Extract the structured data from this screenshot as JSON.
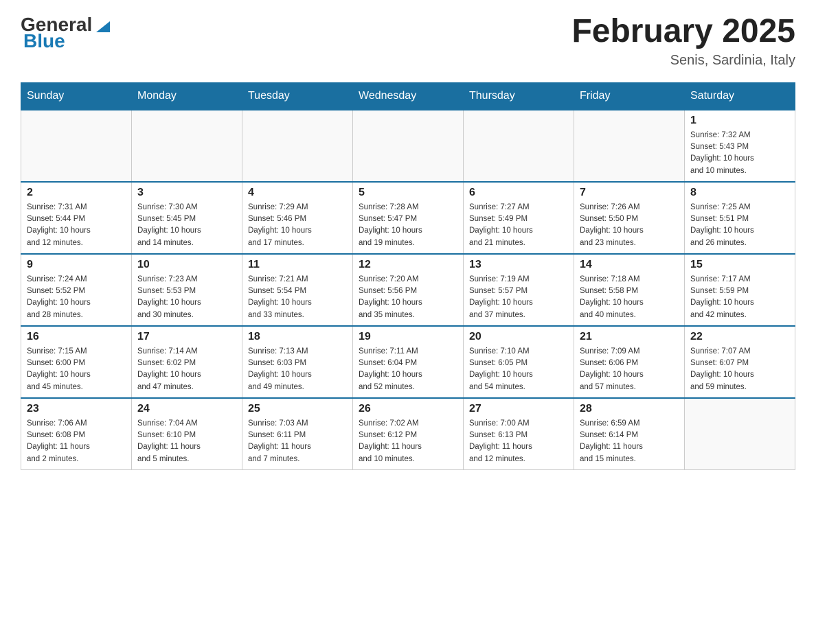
{
  "header": {
    "logo_general": "General",
    "logo_blue": "Blue",
    "month_title": "February 2025",
    "location": "Senis, Sardinia, Italy"
  },
  "days_of_week": [
    "Sunday",
    "Monday",
    "Tuesday",
    "Wednesday",
    "Thursday",
    "Friday",
    "Saturday"
  ],
  "weeks": [
    [
      {
        "day": "",
        "info": ""
      },
      {
        "day": "",
        "info": ""
      },
      {
        "day": "",
        "info": ""
      },
      {
        "day": "",
        "info": ""
      },
      {
        "day": "",
        "info": ""
      },
      {
        "day": "",
        "info": ""
      },
      {
        "day": "1",
        "info": "Sunrise: 7:32 AM\nSunset: 5:43 PM\nDaylight: 10 hours\nand 10 minutes."
      }
    ],
    [
      {
        "day": "2",
        "info": "Sunrise: 7:31 AM\nSunset: 5:44 PM\nDaylight: 10 hours\nand 12 minutes."
      },
      {
        "day": "3",
        "info": "Sunrise: 7:30 AM\nSunset: 5:45 PM\nDaylight: 10 hours\nand 14 minutes."
      },
      {
        "day": "4",
        "info": "Sunrise: 7:29 AM\nSunset: 5:46 PM\nDaylight: 10 hours\nand 17 minutes."
      },
      {
        "day": "5",
        "info": "Sunrise: 7:28 AM\nSunset: 5:47 PM\nDaylight: 10 hours\nand 19 minutes."
      },
      {
        "day": "6",
        "info": "Sunrise: 7:27 AM\nSunset: 5:49 PM\nDaylight: 10 hours\nand 21 minutes."
      },
      {
        "day": "7",
        "info": "Sunrise: 7:26 AM\nSunset: 5:50 PM\nDaylight: 10 hours\nand 23 minutes."
      },
      {
        "day": "8",
        "info": "Sunrise: 7:25 AM\nSunset: 5:51 PM\nDaylight: 10 hours\nand 26 minutes."
      }
    ],
    [
      {
        "day": "9",
        "info": "Sunrise: 7:24 AM\nSunset: 5:52 PM\nDaylight: 10 hours\nand 28 minutes."
      },
      {
        "day": "10",
        "info": "Sunrise: 7:23 AM\nSunset: 5:53 PM\nDaylight: 10 hours\nand 30 minutes."
      },
      {
        "day": "11",
        "info": "Sunrise: 7:21 AM\nSunset: 5:54 PM\nDaylight: 10 hours\nand 33 minutes."
      },
      {
        "day": "12",
        "info": "Sunrise: 7:20 AM\nSunset: 5:56 PM\nDaylight: 10 hours\nand 35 minutes."
      },
      {
        "day": "13",
        "info": "Sunrise: 7:19 AM\nSunset: 5:57 PM\nDaylight: 10 hours\nand 37 minutes."
      },
      {
        "day": "14",
        "info": "Sunrise: 7:18 AM\nSunset: 5:58 PM\nDaylight: 10 hours\nand 40 minutes."
      },
      {
        "day": "15",
        "info": "Sunrise: 7:17 AM\nSunset: 5:59 PM\nDaylight: 10 hours\nand 42 minutes."
      }
    ],
    [
      {
        "day": "16",
        "info": "Sunrise: 7:15 AM\nSunset: 6:00 PM\nDaylight: 10 hours\nand 45 minutes."
      },
      {
        "day": "17",
        "info": "Sunrise: 7:14 AM\nSunset: 6:02 PM\nDaylight: 10 hours\nand 47 minutes."
      },
      {
        "day": "18",
        "info": "Sunrise: 7:13 AM\nSunset: 6:03 PM\nDaylight: 10 hours\nand 49 minutes."
      },
      {
        "day": "19",
        "info": "Sunrise: 7:11 AM\nSunset: 6:04 PM\nDaylight: 10 hours\nand 52 minutes."
      },
      {
        "day": "20",
        "info": "Sunrise: 7:10 AM\nSunset: 6:05 PM\nDaylight: 10 hours\nand 54 minutes."
      },
      {
        "day": "21",
        "info": "Sunrise: 7:09 AM\nSunset: 6:06 PM\nDaylight: 10 hours\nand 57 minutes."
      },
      {
        "day": "22",
        "info": "Sunrise: 7:07 AM\nSunset: 6:07 PM\nDaylight: 10 hours\nand 59 minutes."
      }
    ],
    [
      {
        "day": "23",
        "info": "Sunrise: 7:06 AM\nSunset: 6:08 PM\nDaylight: 11 hours\nand 2 minutes."
      },
      {
        "day": "24",
        "info": "Sunrise: 7:04 AM\nSunset: 6:10 PM\nDaylight: 11 hours\nand 5 minutes."
      },
      {
        "day": "25",
        "info": "Sunrise: 7:03 AM\nSunset: 6:11 PM\nDaylight: 11 hours\nand 7 minutes."
      },
      {
        "day": "26",
        "info": "Sunrise: 7:02 AM\nSunset: 6:12 PM\nDaylight: 11 hours\nand 10 minutes."
      },
      {
        "day": "27",
        "info": "Sunrise: 7:00 AM\nSunset: 6:13 PM\nDaylight: 11 hours\nand 12 minutes."
      },
      {
        "day": "28",
        "info": "Sunrise: 6:59 AM\nSunset: 6:14 PM\nDaylight: 11 hours\nand 15 minutes."
      },
      {
        "day": "",
        "info": ""
      }
    ]
  ]
}
